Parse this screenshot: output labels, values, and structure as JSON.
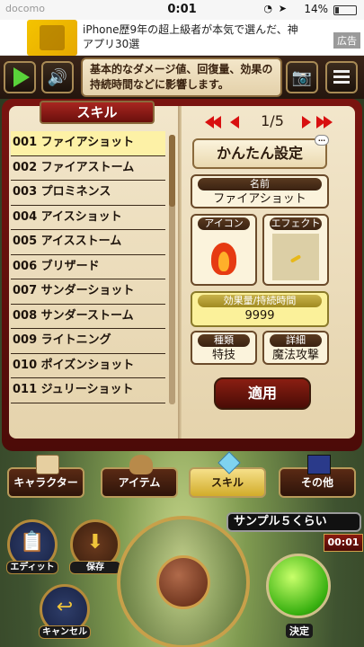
{
  "status": {
    "carrier": "docomo",
    "time": "0:01",
    "battery": "14%"
  },
  "ad": {
    "text": "iPhone歴9年の超上級者が本気で選んだ、神アプリ30選",
    "badge": "広告"
  },
  "topbar": {
    "tip": "基本的なダメージ値、回復量、効果の持続時間などに影響します。"
  },
  "book": {
    "tab": "スキル",
    "skills": [
      "001 ファイアショット",
      "002 ファイアストーム",
      "003 プロミネンス",
      "004 アイスショット",
      "005 アイスストーム",
      "006 ブリザード",
      "007 サンダーショット",
      "008 サンダーストーム",
      "009 ライトニング",
      "010 ポイズンショット",
      "011 ジュリーショット"
    ],
    "selected_index": 0
  },
  "detail": {
    "page": "1/5",
    "mode_button": "かんたん設定",
    "name_label": "名前",
    "name_value": "ファイアショット",
    "icon_label": "アイコン",
    "effect_label": "エフェクト",
    "amount_label": "効果量/持続時間",
    "amount_value": "9999",
    "type_label": "種類",
    "type_value": "特技",
    "detail_label": "詳細",
    "detail_value": "魔法攻撃",
    "apply": "適用"
  },
  "tabs": [
    {
      "label": "キャラクター",
      "icon": "scroll-icon"
    },
    {
      "label": "アイテム",
      "icon": "bag-icon"
    },
    {
      "label": "スキル",
      "icon": "crystal-icon",
      "active": true
    },
    {
      "label": "その他",
      "icon": "flag-icon"
    }
  ],
  "controls": {
    "edit": "エディット",
    "save": "保存",
    "cancel": "キャンセル",
    "sample": "サンプル５くらい",
    "timer": "00:01",
    "decide": "決定"
  }
}
